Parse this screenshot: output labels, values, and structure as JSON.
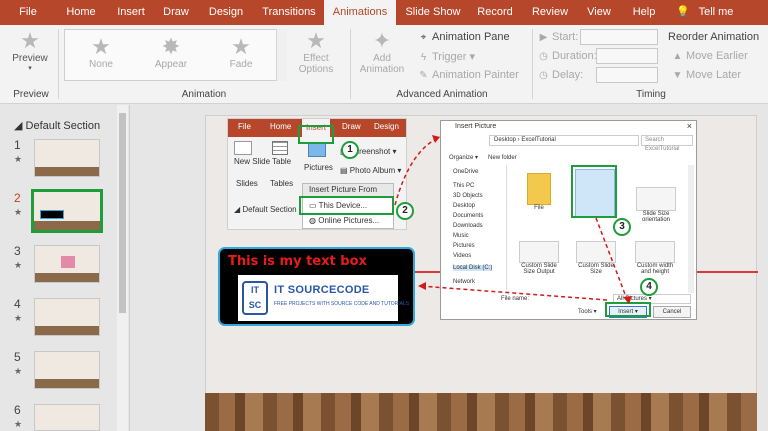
{
  "tabs": [
    "File",
    "Home",
    "Insert",
    "Draw",
    "Design",
    "Transitions",
    "Animations",
    "Slide Show",
    "Record",
    "Review",
    "View",
    "Help",
    "Tell me"
  ],
  "ribbon": {
    "preview": {
      "label": "Preview",
      "group": "Preview"
    },
    "animation_gallery": [
      "None",
      "Appear",
      "Fade"
    ],
    "effect_options": "Effect Options",
    "animation_group": "Animation",
    "add_animation": "Add Animation",
    "animation_pane": "Animation Pane",
    "trigger": "Trigger",
    "animation_painter": "Animation Painter",
    "advanced_group": "Advanced Animation",
    "start": "Start:",
    "duration": "Duration:",
    "delay": "Delay:",
    "reorder": "Reorder Animation",
    "move_earlier": "Move Earlier",
    "move_later": "Move Later",
    "timing_group": "Timing"
  },
  "thumbnails": {
    "section": "Default Section",
    "slides": [
      "1",
      "2",
      "3",
      "4",
      "5",
      "6"
    ],
    "selected": "2"
  },
  "inset_ribbon": {
    "tabs": [
      "File",
      "Home",
      "Insert",
      "Draw",
      "Design"
    ],
    "new_slide": "New Slide",
    "slides_group": "Slides",
    "table": "Table",
    "tables_group": "Tables",
    "pictures": "Pictures",
    "screenshot": "Screenshot",
    "photo_album": "Photo Album",
    "section": "Default Section",
    "menu_header": "Insert Picture From",
    "this_device": "This Device...",
    "online_pictures": "Online Pictures..."
  },
  "dialog": {
    "title": "Insert Picture",
    "address": "Desktop › ExcelTutorial",
    "search": "Search ExcelTutorial",
    "organize": "Organize ▾",
    "new_folder": "New folder",
    "nav": [
      "OneDrive",
      "This PC",
      "3D Objects",
      "Desktop",
      "Documents",
      "Downloads",
      "Music",
      "Pictures",
      "Videos",
      "Local Disk (C:)",
      "Network"
    ],
    "selected_nav": "Local Disk (C:)",
    "files": [
      "File",
      "Custom Slide Size Output",
      "Custom Slide Size",
      "Custom width and height",
      "Slide Size orientation"
    ],
    "file_name_label": "File name:",
    "filter": "All Pictures",
    "tools": "Tools",
    "insert": "Insert",
    "cancel": "Cancel"
  },
  "textbox": {
    "title": "This is my text box",
    "logo_mark": "IT SC",
    "logo_name": "IT SOURCECODE",
    "logo_tagline": "FREE PROJECTS WITH SOURCE CODE AND TUTORIALS"
  },
  "steps": [
    "1",
    "2",
    "3",
    "4"
  ],
  "colors": {
    "accent": "#b7472a",
    "highlight": "#1f9d3b",
    "callout": "#e81c1c"
  }
}
